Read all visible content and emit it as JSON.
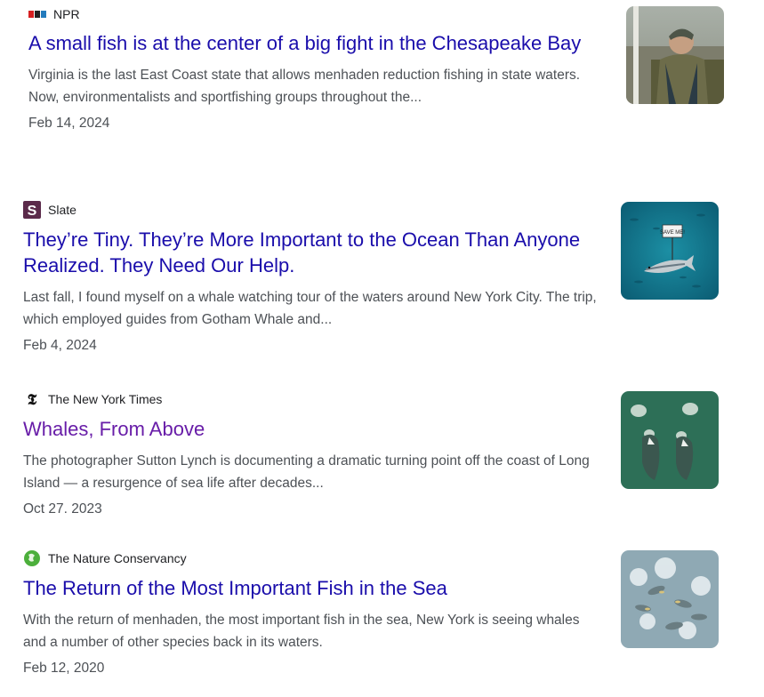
{
  "results": [
    {
      "source": "NPR",
      "title": "A small fish is at the center of a big fight in the Chesapeake Bay",
      "snippet": "Virginia is the last East Coast state that allows menhaden reduction fishing in state waters. Now, environmentalists and sportfishing groups throughout the...",
      "date": "Feb 14, 2024",
      "favicon": "npr-icon",
      "thumbnail": "fisherman-on-boat"
    },
    {
      "source": "Slate",
      "title": "They’re Tiny. They’re More Important to the Ocean Than Anyone Realized. They Need Our Help.",
      "snippet": "Last fall, I found myself on a whale watching tour of the waters around New York City. The trip, which employed guides from Gotham Whale and...",
      "date": "Feb 4, 2024",
      "favicon": "slate-icon",
      "thumbnail": "fish-with-sign",
      "thumb_sign": "SAVE ME!"
    },
    {
      "source": "The New York Times",
      "title": "Whales, From Above",
      "snippet": "The photographer Sutton Lynch is documenting a dramatic turning point off the coast of Long Island — a resurgence of sea life after decades...",
      "date": "Oct 27, 2023",
      "favicon": "nyt-icon",
      "thumbnail": "whales-aerial"
    },
    {
      "source": "The Nature Conservancy",
      "title": "The Return of the Most Important Fish in the Sea",
      "snippet": "With the return of menhaden, the most important fish in the sea, New York is seeing whales and a number of other species back in its waters.",
      "date": "Feb 12, 2020",
      "favicon": "nature-conservancy-icon",
      "thumbnail": "menhaden-school"
    }
  ],
  "colors": {
    "link": "#1a0dab",
    "visited_link": "#681da8",
    "snippet": "#4d5156"
  }
}
